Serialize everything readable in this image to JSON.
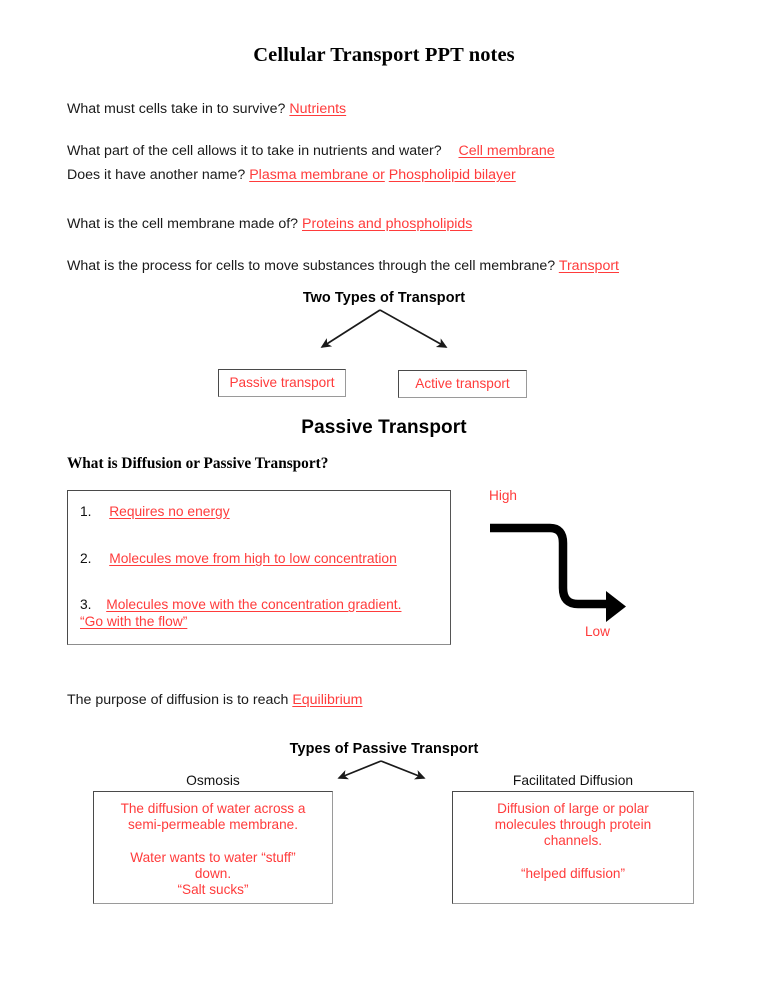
{
  "document": {
    "title": "Cellular Transport PPT notes"
  },
  "qa": [
    {
      "question": "What must cells take in to survive?",
      "answer": "Nutrients"
    },
    {
      "question": "What part of the cell allows it to take in nutrients and water?",
      "answer": "Cell membrane"
    },
    {
      "question": "Does it have another name?",
      "answer": "Plasma membrane or",
      "answer2": "Phospholipid bilayer"
    },
    {
      "question": "What is the cell membrane made of?",
      "answer": "Proteins and phospholipids"
    },
    {
      "question": "What is the process for cells to move substances through the cell membrane?",
      "answer": "Transport"
    }
  ],
  "diagram1": {
    "heading": "Two Types of Transport",
    "left_box": "Passive transport",
    "right_box": "Active transport"
  },
  "section_passive": {
    "heading": "Passive Transport",
    "question": "What is Diffusion or Passive Transport?",
    "list": [
      {
        "num": "1.",
        "text": "Requires no energy"
      },
      {
        "num": "2.",
        "text": "Molecules move from high to low concentration"
      },
      {
        "num": "3.",
        "text": "Molecules move with the concentration gradient.",
        "text_line2": "“Go with the flow”"
      }
    ],
    "gradient": {
      "high_label": "High",
      "low_label": "Low"
    }
  },
  "equilibrium_line": {
    "question": "The purpose of diffusion is to reach",
    "answer": "Equilibrium"
  },
  "diagram2": {
    "heading": "Types of Passive Transport",
    "left_caption": "Osmosis",
    "right_caption": "Facilitated Diffusion",
    "left_box": {
      "line1": "The diffusion of water across a",
      "line2": "semi-permeable membrane.",
      "line3": "Water wants to water “stuff”",
      "line4": "down.",
      "line5": "“Salt sucks”"
    },
    "right_box": {
      "line1": "Diffusion of large or polar",
      "line2": "molecules through protein",
      "line3": "channels.",
      "line4": "“helped diffusion”"
    }
  },
  "colors": {
    "answer_red": "#ff3b3b",
    "text_black": "#111111",
    "box_border": "#4a4a4a"
  }
}
